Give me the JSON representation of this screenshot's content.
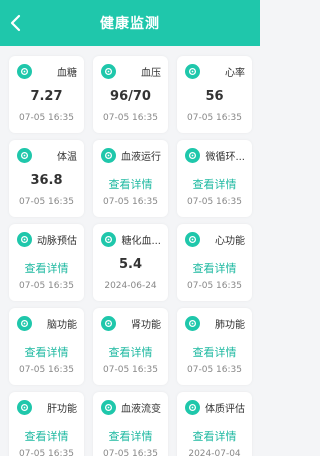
{
  "header": {
    "title": "健康监测",
    "back_icon": "chevron-left-icon"
  },
  "accent": "#1fc7ab",
  "cards": [
    {
      "name": "血糖",
      "value": "7.27",
      "date": "07-05 16:35",
      "icon": "blood-sugar-icon"
    },
    {
      "name": "血压",
      "value": "96/70",
      "date": "07-05 16:35",
      "icon": "blood-pressure-icon"
    },
    {
      "name": "心率",
      "value": "56",
      "date": "07-05 16:35",
      "icon": "heart-rate-icon"
    },
    {
      "name": "体温",
      "value": "36.8",
      "date": "07-05 16:35",
      "icon": "thermometer-icon"
    },
    {
      "name": "血液运行",
      "link": "查看详情",
      "date": "07-05 16:35",
      "icon": "blood-circulation-icon"
    },
    {
      "name": "微循环...",
      "link": "查看详情",
      "date": "07-05 16:35",
      "icon": "microcirculation-icon"
    },
    {
      "name": "动脉预估",
      "link": "查看详情",
      "date": "07-05 16:35",
      "icon": "artery-icon"
    },
    {
      "name": "糖化血...",
      "value": "5.4",
      "date": "2024-06-24",
      "icon": "glycated-hemoglobin-icon"
    },
    {
      "name": "心功能",
      "link": "查看详情",
      "date": "07-05 16:35",
      "icon": "heart-function-icon"
    },
    {
      "name": "脑功能",
      "link": "查看详情",
      "date": "07-05 16:35",
      "icon": "brain-icon"
    },
    {
      "name": "肾功能",
      "link": "查看详情",
      "date": "07-05 16:35",
      "icon": "kidney-icon"
    },
    {
      "name": "肺功能",
      "link": "查看详情",
      "date": "07-05 16:35",
      "icon": "lung-icon"
    },
    {
      "name": "肝功能",
      "link": "查看详情",
      "date": "07-05 16:35",
      "icon": "liver-icon"
    },
    {
      "name": "血液流变",
      "link": "查看详情",
      "date": "07-05 16:35",
      "icon": "blood-rheology-icon"
    },
    {
      "name": "体质评估",
      "link": "查看详情",
      "date": "2024-07-04",
      "icon": "constitution-icon"
    }
  ]
}
